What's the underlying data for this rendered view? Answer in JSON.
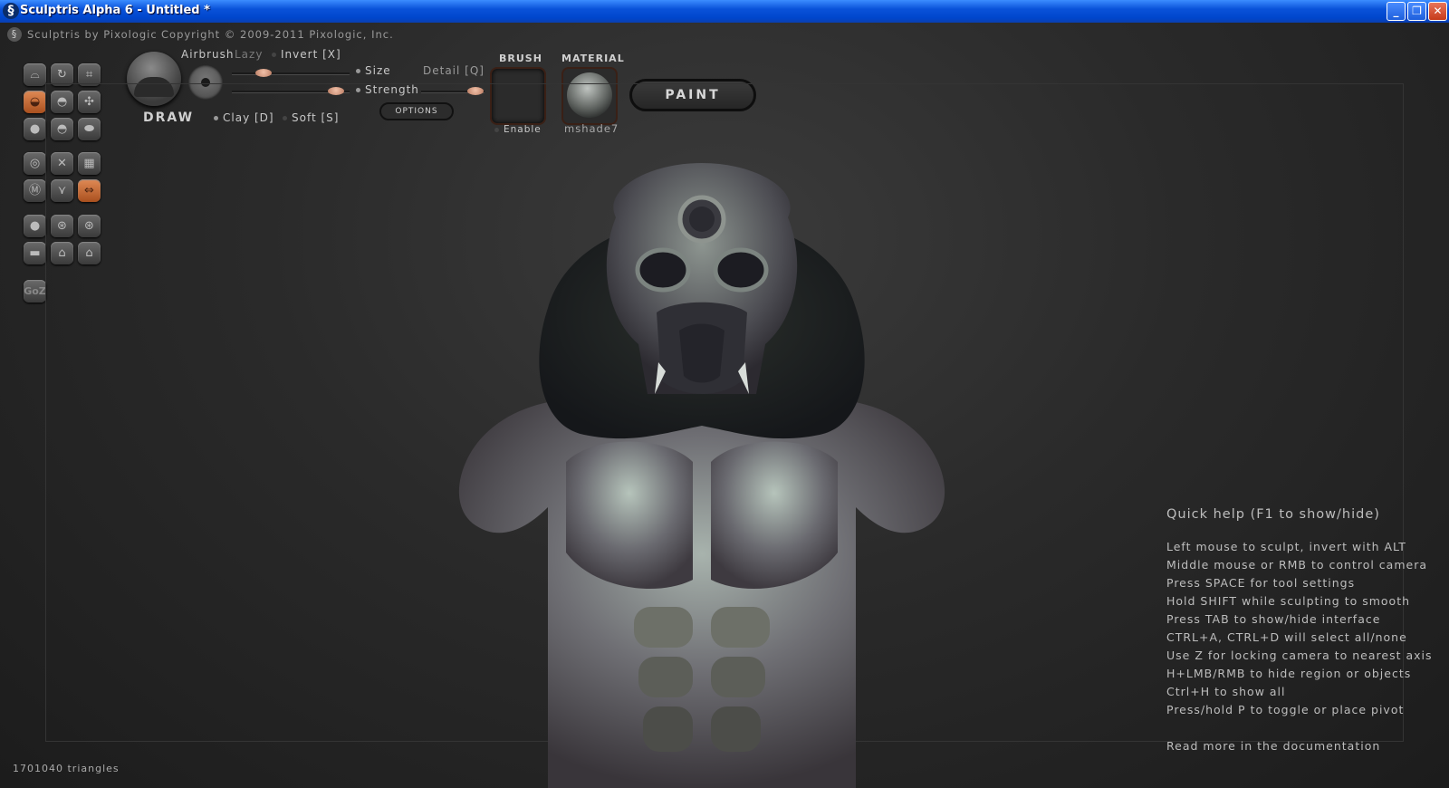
{
  "window": {
    "title": "Sculptris Alpha 6 - Untitled *",
    "icon": "sculptris-logo-icon",
    "controls": {
      "minimize": "_",
      "maximize": "❐",
      "close": "✕"
    }
  },
  "header": {
    "by": "Sculptris by Pixologic",
    "copyright": "Copyright © 2009-2011 Pixologic, Inc."
  },
  "tool_palette": {
    "groups": [
      [
        "draw-tool",
        "rotate-tool",
        "crop-tool",
        "clay-tool",
        "inflate-tool",
        "pinch-tool",
        "crease-tool",
        "flatten-tool",
        "smooth-tool"
      ],
      [
        "grab-tool",
        "scale-tool",
        "reduce-tool",
        "wire-tool",
        "symmetry-tool",
        "mask-tool"
      ],
      [
        "sphere-tool",
        "import-tool",
        "export-tool",
        "plane-tool",
        "save-tool",
        "open-tool"
      ]
    ],
    "active": [
      "clay-tool",
      "mask-tool"
    ],
    "goz_label": "GoZ"
  },
  "toolbar": {
    "tool_name": "DRAW",
    "airbrush_label": "Airbrush",
    "lazy_label": "Lazy",
    "invert_label": "Invert [X]",
    "size_label": "Size",
    "strength_label": "Strength",
    "detail_label": "Detail [Q]",
    "size_value": 0.3,
    "strength_value": 0.95,
    "detail_value": 0.9,
    "clay_label": "Clay [D]",
    "soft_label": "Soft [S]",
    "options_label": "OPTIONS",
    "brush_title": "BRUSH",
    "brush_enable_label": "Enable",
    "material_title": "MATERIAL",
    "material_name": "mshade7",
    "paint_label": "PAINT"
  },
  "quick_help": {
    "title": "Quick help (F1 to show/hide)",
    "lines": [
      "Left mouse to sculpt, invert with ALT",
      "Middle mouse or RMB to control camera",
      "Press SPACE for tool settings",
      "Hold SHIFT while sculpting to smooth",
      "Press TAB to show/hide interface",
      "CTRL+A, CTRL+D will select all/none",
      "Use Z for locking camera to nearest axis",
      "H+LMB/RMB to hide region or objects",
      "Ctrl+H to show all",
      "Press/hold P to toggle or place pivot"
    ],
    "link": "Read more in the documentation"
  },
  "status": {
    "triangles": "1701040 triangles"
  }
}
